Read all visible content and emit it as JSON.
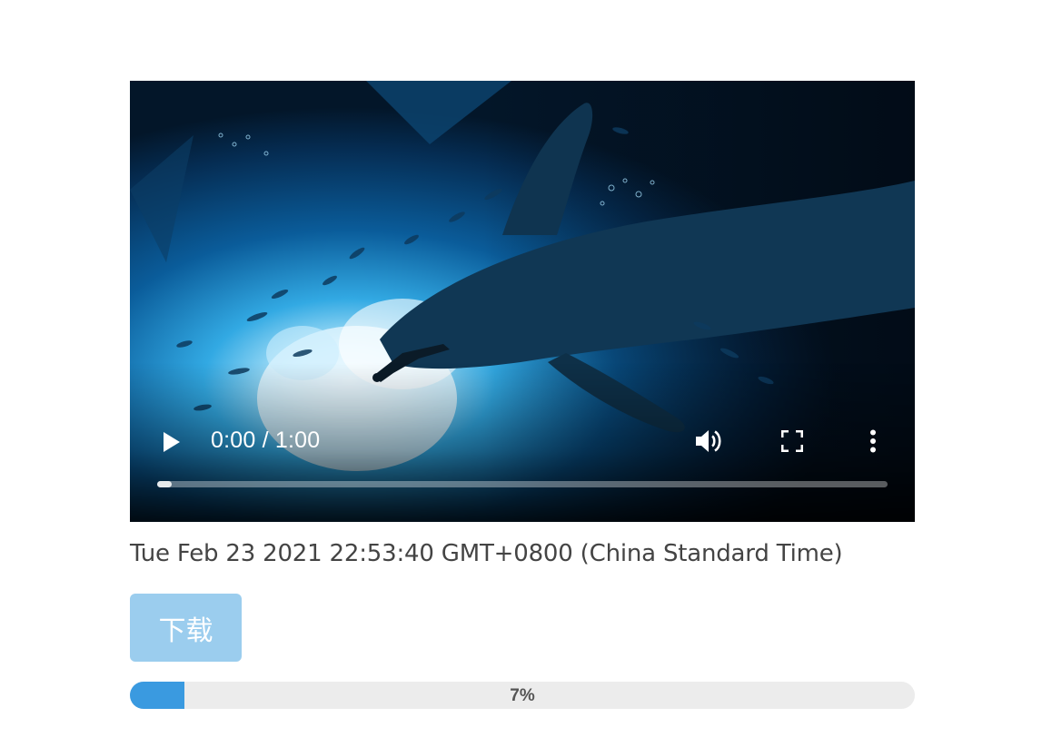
{
  "video": {
    "current_time": "0:00",
    "duration": "1:00",
    "time_display": "0:00 / 1:00",
    "seek_fraction": 0.0,
    "icons": [
      "play-icon",
      "volume-icon",
      "fullscreen-icon",
      "more-vert-icon"
    ]
  },
  "date_text": "Tue Feb 23 2021 22:53:40 GMT+0800 (China Standard Time)",
  "download_button": {
    "label": "下载",
    "color": "#9bcdee"
  },
  "progress": {
    "value": 7,
    "label": "7%",
    "fill_color": "#3a9ae0",
    "track_color": "#ececec"
  }
}
